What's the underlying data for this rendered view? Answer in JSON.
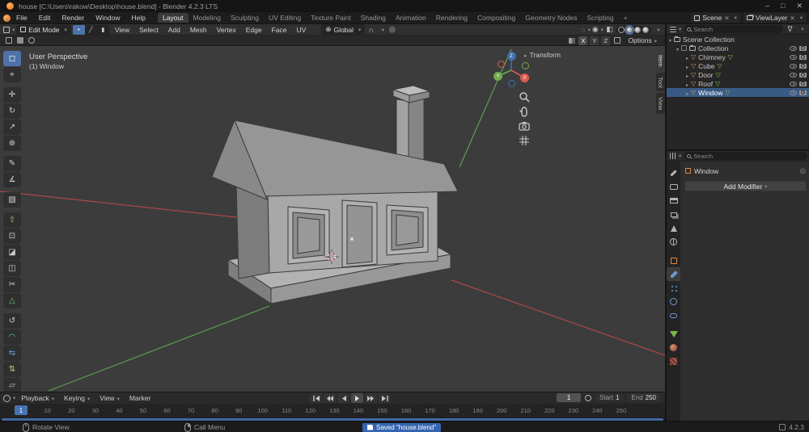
{
  "window": {
    "title": "house [C:\\Users\\rakow\\Desktop\\house.blend] - Blender 4.2.3 LTS",
    "minimize_glyph": "–",
    "maximize_glyph": "□",
    "close_glyph": "✕"
  },
  "topbar": {
    "menus": [
      "File",
      "Edit",
      "Render",
      "Window",
      "Help"
    ],
    "workspaces": [
      "Layout",
      "Modeling",
      "Sculpting",
      "UV Editing",
      "Texture Paint",
      "Shading",
      "Animation",
      "Rendering",
      "Compositing",
      "Geometry Nodes",
      "Scripting"
    ],
    "add_tab": "+",
    "scene": {
      "label": "Scene",
      "unlink": "✕"
    },
    "view_layer": {
      "label": "ViewLayer",
      "unlink": "✕"
    }
  },
  "viewport": {
    "header": {
      "mode": "Edit Mode",
      "select_modes": [
        "•",
        "╱",
        "▮"
      ],
      "menus": [
        "View",
        "Select",
        "Add",
        "Mesh",
        "Vertex",
        "Edge",
        "Face",
        "UV"
      ],
      "orientation": "Global"
    },
    "tool_settings": {
      "axes": [
        "X",
        "Y",
        "Z"
      ],
      "options": "Options"
    },
    "overlay": {
      "view_label": "User Perspective",
      "object_label": "(1) Window",
      "transform_panel": "Transform",
      "sidebar_tabs": [
        "Item",
        "Tool",
        "View"
      ],
      "gizmo": {
        "x": "X",
        "y": "Y",
        "z": "Z"
      }
    },
    "tools": [
      {
        "name": "select-box",
        "glyph": "◻"
      },
      {
        "name": "cursor",
        "glyph": "⌖"
      },
      {
        "name": "move",
        "glyph": "✛"
      },
      {
        "name": "rotate",
        "glyph": "↻"
      },
      {
        "name": "scale",
        "glyph": "↗"
      },
      {
        "name": "transform",
        "glyph": "⊕"
      },
      {
        "name": "annotate",
        "glyph": "✎"
      },
      {
        "name": "measure",
        "glyph": "∡"
      },
      {
        "name": "add-cube",
        "glyph": "▧"
      },
      {
        "name": "extrude-region",
        "glyph": "⇧"
      },
      {
        "name": "inset-faces",
        "glyph": "⊡"
      },
      {
        "name": "bevel",
        "glyph": "◪"
      },
      {
        "name": "loop-cut",
        "glyph": "◫"
      },
      {
        "name": "knife",
        "glyph": "✂"
      },
      {
        "name": "poly-build",
        "glyph": "△"
      },
      {
        "name": "spin",
        "glyph": "↺"
      },
      {
        "name": "smooth",
        "glyph": "◠"
      },
      {
        "name": "edge-slide",
        "glyph": "⇆"
      },
      {
        "name": "shrink-fatten",
        "glyph": "⇅"
      },
      {
        "name": "shear",
        "glyph": "▱"
      }
    ]
  },
  "outliner": {
    "search_placeholder": "Search",
    "scene_collection": "Scene Collection",
    "collection": "Collection",
    "objects": [
      "Chimney",
      "Cube",
      "Door",
      "Roof",
      "Window"
    ],
    "selected_object": "Window"
  },
  "properties": {
    "search_placeholder": "Search",
    "object_name": "Window",
    "add_modifier": "Add Modifier"
  },
  "timeline": {
    "menus": [
      "Playback",
      "Keying",
      "View",
      "Marker"
    ],
    "current_frame": "1",
    "playhead": "1",
    "start_label": "Start",
    "start_value": "1",
    "end_label": "End",
    "end_value": "250",
    "ticks": [
      "10",
      "20",
      "30",
      "40",
      "50",
      "60",
      "70",
      "80",
      "90",
      "100",
      "110",
      "120",
      "130",
      "140",
      "150",
      "160",
      "170",
      "180",
      "190",
      "200",
      "210",
      "220",
      "230",
      "240",
      "250"
    ]
  },
  "statusbar": {
    "hint_rotate": "Rotate View",
    "hint_menu": "Call Menu",
    "notification": "Saved \"house.blend\"",
    "version": "4.2.3"
  },
  "icons": {
    "chevron_down": "▾",
    "chevron_right": "▸",
    "mesh_object": "▽",
    "mesh_data": "▽",
    "funnel": "∇",
    "magnet": "∩",
    "proportional": "◎",
    "globe": "⊕",
    "xray": "◧",
    "overlays": "◉",
    "gizmos": "◌",
    "pin": "◎"
  },
  "colors": {
    "accent_blue": "#4772b3",
    "selection_row": "#3a5a86",
    "blender_orange": "#e8720c",
    "mesh_green": "#7ac142",
    "axis_red": "#ad4848",
    "axis_green": "#5f9e52",
    "viewport_bg": "#3c3c3d",
    "saved_pill": "#3565b0"
  }
}
